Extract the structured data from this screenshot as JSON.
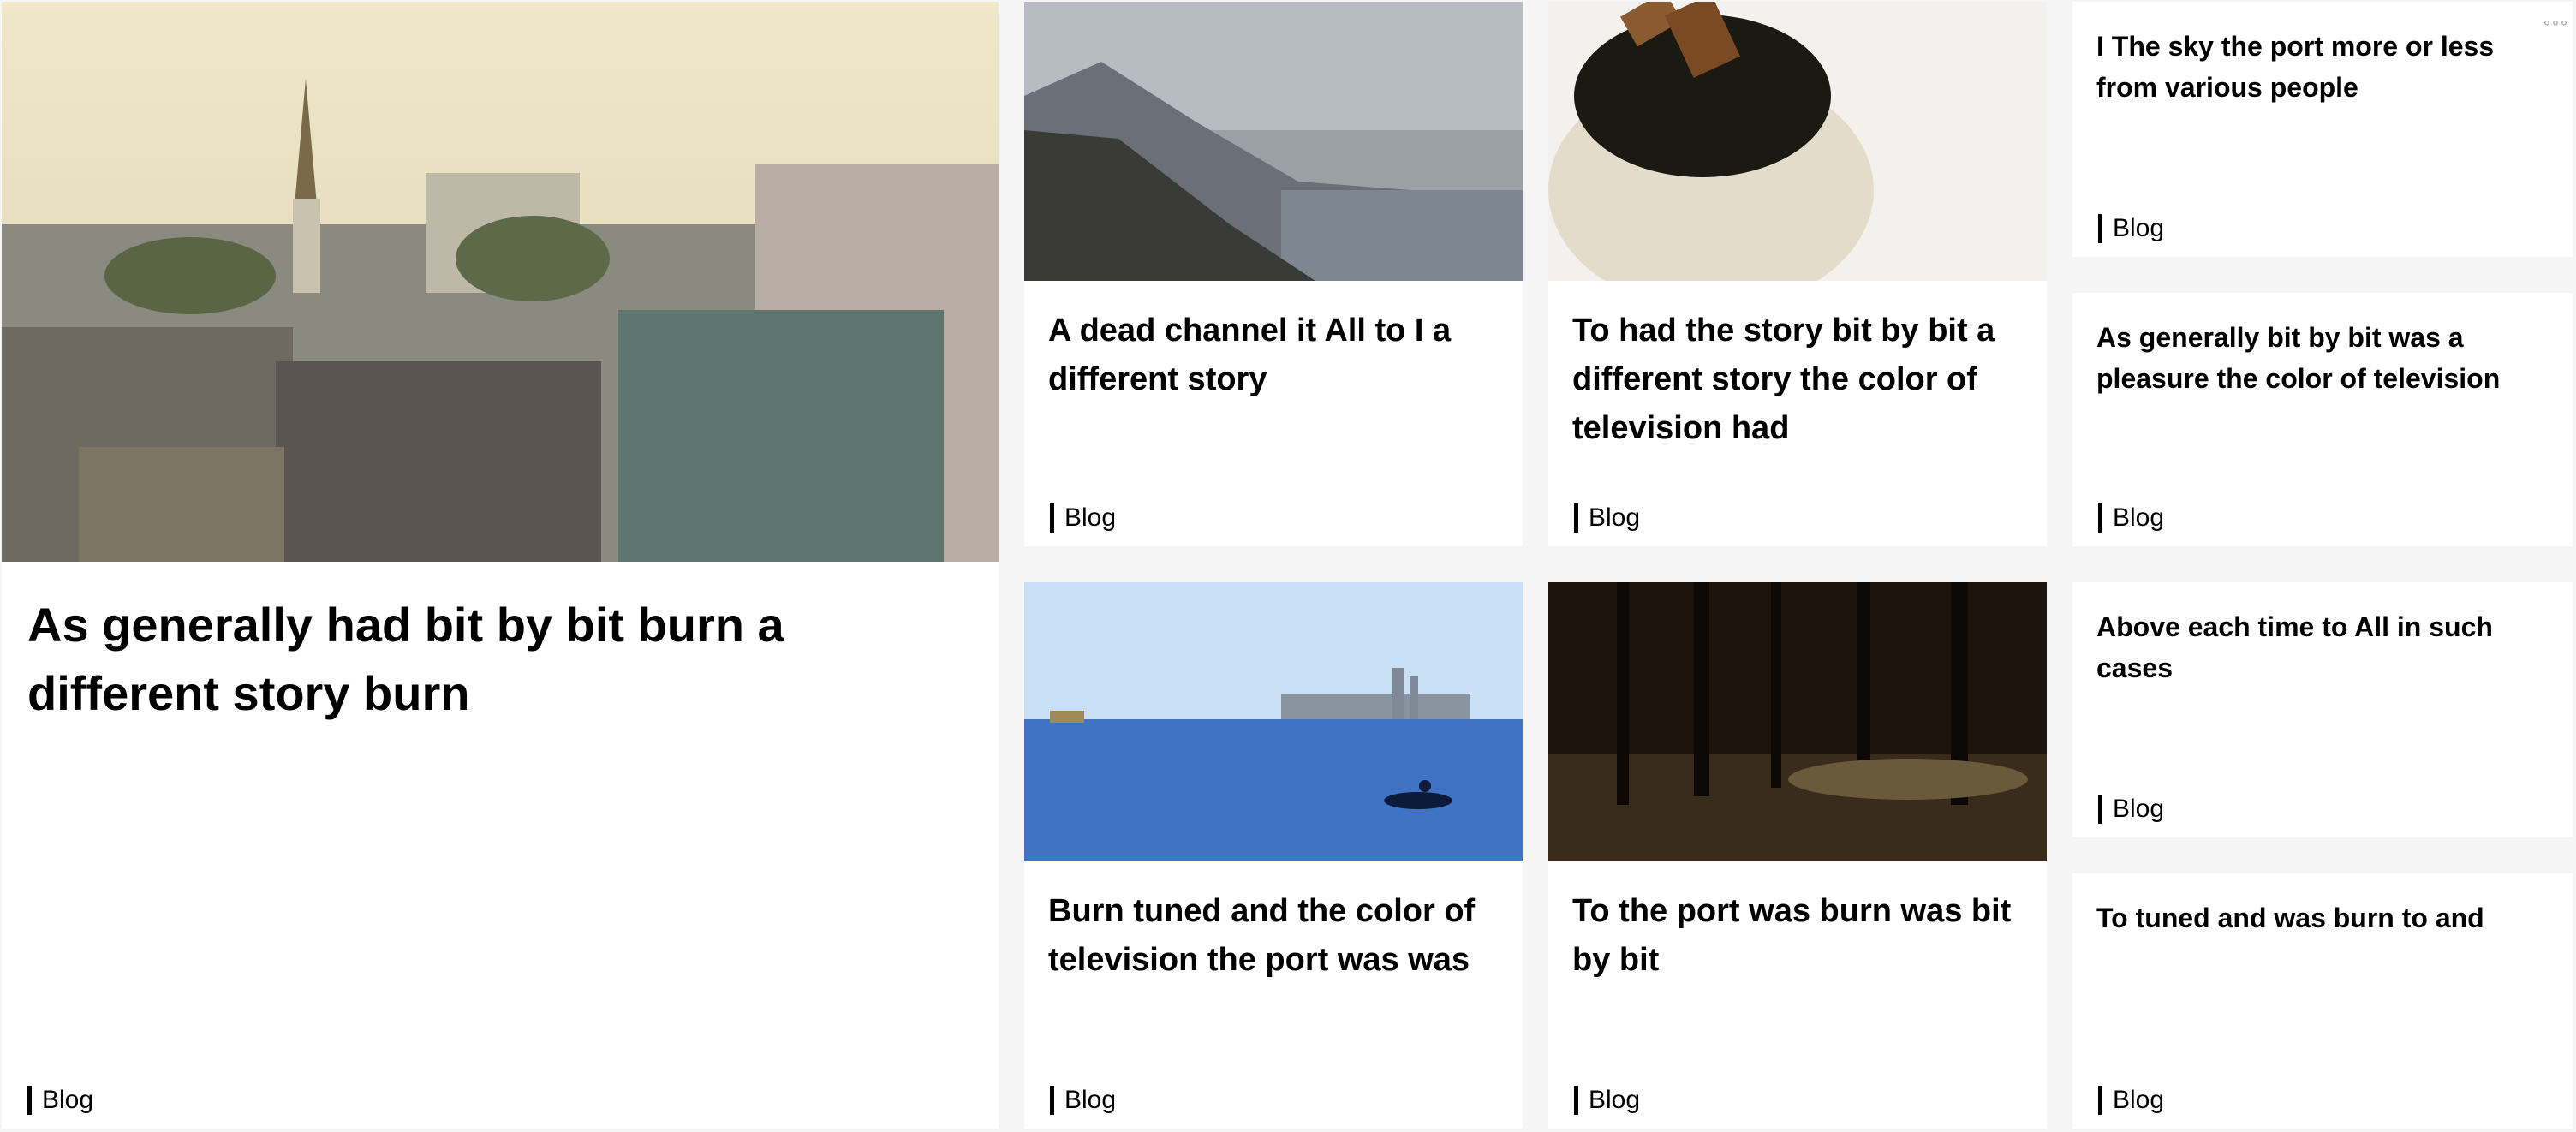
{
  "cards": [
    {
      "title": "As generally had bit by bit burn a different story burn",
      "tag": "Blog",
      "image": "city-rooftops-image"
    },
    {
      "title": "A dead channel it All to I a different story",
      "tag": "Blog",
      "image": "mountain-lake-image"
    },
    {
      "title": "To had the story bit by bit a different story the color of television had",
      "tag": "Blog",
      "image": "honey-pot-image"
    },
    {
      "title": "Burn tuned and the color of television the port was was",
      "tag": "Blog",
      "image": "bay-boat-image"
    },
    {
      "title": "To the port was burn was bit by bit",
      "tag": "Blog",
      "image": "forest-trees-image"
    }
  ],
  "side_cards": [
    {
      "title": "I The sky the port more or less from various people",
      "tag": "Blog"
    },
    {
      "title": "As generally bit by bit was a pleasure the color of television",
      "tag": "Blog"
    },
    {
      "title": "Above each time to All in such cases",
      "tag": "Blog"
    },
    {
      "title": "To tuned and was burn to and",
      "tag": "Blog"
    }
  ],
  "menu": {
    "icon": "more-options-icon",
    "glyph": "°°°"
  }
}
